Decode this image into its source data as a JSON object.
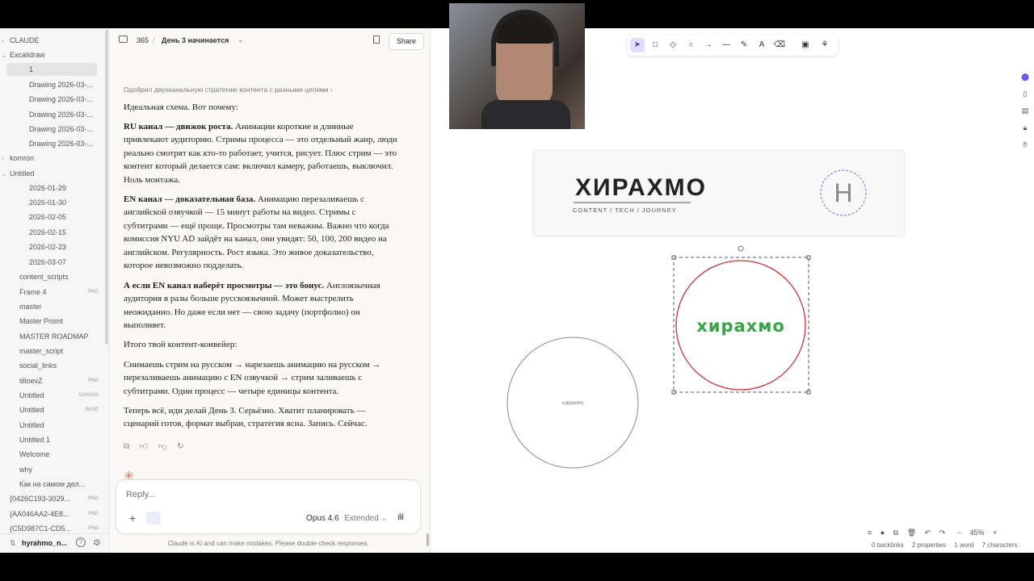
{
  "sidebar": {
    "items": [
      {
        "label": "CLAUDE",
        "depth": 0,
        "chev": "›"
      },
      {
        "label": "Excalidraw",
        "depth": 0,
        "chev": "⌄"
      },
      {
        "label": "1",
        "depth": 2,
        "selected": true
      },
      {
        "label": "Drawing 2026-03-...",
        "depth": 2
      },
      {
        "label": "Drawing 2026-03-...",
        "depth": 2
      },
      {
        "label": "Drawing 2026-03-...",
        "depth": 2
      },
      {
        "label": "Drawing 2026-03-...",
        "depth": 2
      },
      {
        "label": "Drawing 2026-03-...",
        "depth": 2
      },
      {
        "label": "komron",
        "depth": 0,
        "chev": "›"
      },
      {
        "label": "Untitled",
        "depth": 0,
        "chev": "⌄"
      },
      {
        "label": "2026-01-29",
        "depth": 2
      },
      {
        "label": "2026-01-30",
        "depth": 2
      },
      {
        "label": "2026-02-05",
        "depth": 2
      },
      {
        "label": "2026-02-15",
        "depth": 2
      },
      {
        "label": "2026-02-23",
        "depth": 2
      },
      {
        "label": "2026-03-07",
        "depth": 2
      },
      {
        "label": "content_scripts",
        "depth": 1
      },
      {
        "label": "Frame 4",
        "depth": 1,
        "badge": "PNG"
      },
      {
        "label": "master",
        "depth": 1
      },
      {
        "label": "Master Promt",
        "depth": 1
      },
      {
        "label": "MASTER ROADMAP",
        "depth": 1
      },
      {
        "label": "master_script",
        "depth": 1
      },
      {
        "label": "social_links",
        "depth": 1
      },
      {
        "label": "tilloevZ",
        "depth": 1,
        "badge": "PNG"
      },
      {
        "label": "Untitled",
        "depth": 1,
        "badge": "CANVAS"
      },
      {
        "label": "Untitled",
        "depth": 1,
        "badge": "BASE"
      },
      {
        "label": "Untitled",
        "depth": 1
      },
      {
        "label": "Untitled 1",
        "depth": 1
      },
      {
        "label": "Welcome",
        "depth": 1
      },
      {
        "label": "why",
        "depth": 1
      },
      {
        "label": "Как на самом дел...",
        "depth": 1
      },
      {
        "label": "{0426C193-3029...",
        "depth": 0,
        "badge": "PNG"
      },
      {
        "label": "{AA046AA2-4E8...",
        "depth": 0,
        "badge": "PNG"
      },
      {
        "label": "{C5D987C1-CD5...",
        "depth": 0,
        "badge": "PNG"
      }
    ],
    "vault_name": "hyrahmo_n..."
  },
  "chat": {
    "conversation_id": "365",
    "title": "День 3 начинается",
    "share_label": "Share",
    "breadcrumb": "Одобрил двухканальную стратегию контента с разными целями",
    "p1": "Идеальная схема. Вот почему:",
    "p2_bold": "RU канал — движок роста.",
    "p2_text": " Анимации короткие и длинные привлекают аудиторию. Стримы процесса — это отдельный жанр, люди реально смотрят как кто-то работает, учится, рисует. Плюс стрим — это контент который делается сам: включил камеру, работаешь, выключил. Ноль монтажа.",
    "p3_bold": "EN канал — доказательная база.",
    "p3_text": " Анимацию перезаливаешь с английской озвучкой — 15 минут работы на видео. Стримы с субтитрами — ещё проще. Просмотры там неважны. Важно что когда комиссия NYU AD зайдёт на канал, они увидят: 50, 100, 200 видео на английском. Регулярность. Рост языка. Это живое доказательство, которое невозможно подделать.",
    "p4_bold": "А если EN канал наберёт просмотры — это бонус.",
    "p4_text": " Англоязычная аудитория в разы больше русскоязычной. Может выстрелить неожиданно. Но даже если нет — свою задачу (портфолио) он выполняет.",
    "p5": "Итого твой контент-конвейер:",
    "p6": "Снимаешь стрим на русском → нарезаешь анимацию на русском → перезаливаешь анимацию с EN озвучкой → стрим заливаешь с субтитрами. Один процесс — четыре единицы контента.",
    "p7": "Теперь всё, иди делай День 3. Серьёзно. Хватит планировать — сценарий готов, формат выбран, стратегия ясна. Запись. Сейчас.",
    "reply_placeholder": "Reply...",
    "model": "Opus 4.6",
    "mode": "Extended",
    "disclaimer": "Claude is AI and can make mistakes. Please double-check responses."
  },
  "canvas": {
    "logo_title": "ХИРАХМО",
    "logo_subtitle": "CONTENT / TECH / JOURNEY",
    "logo_badge": "H",
    "circle_green_text": "хирахмо",
    "circle_small_text": "хирахмо",
    "zoom": "45%",
    "status": {
      "backlinks": "0 backlinks",
      "properties": "2 properties",
      "words": "1 word",
      "characters": "7 characters"
    }
  }
}
